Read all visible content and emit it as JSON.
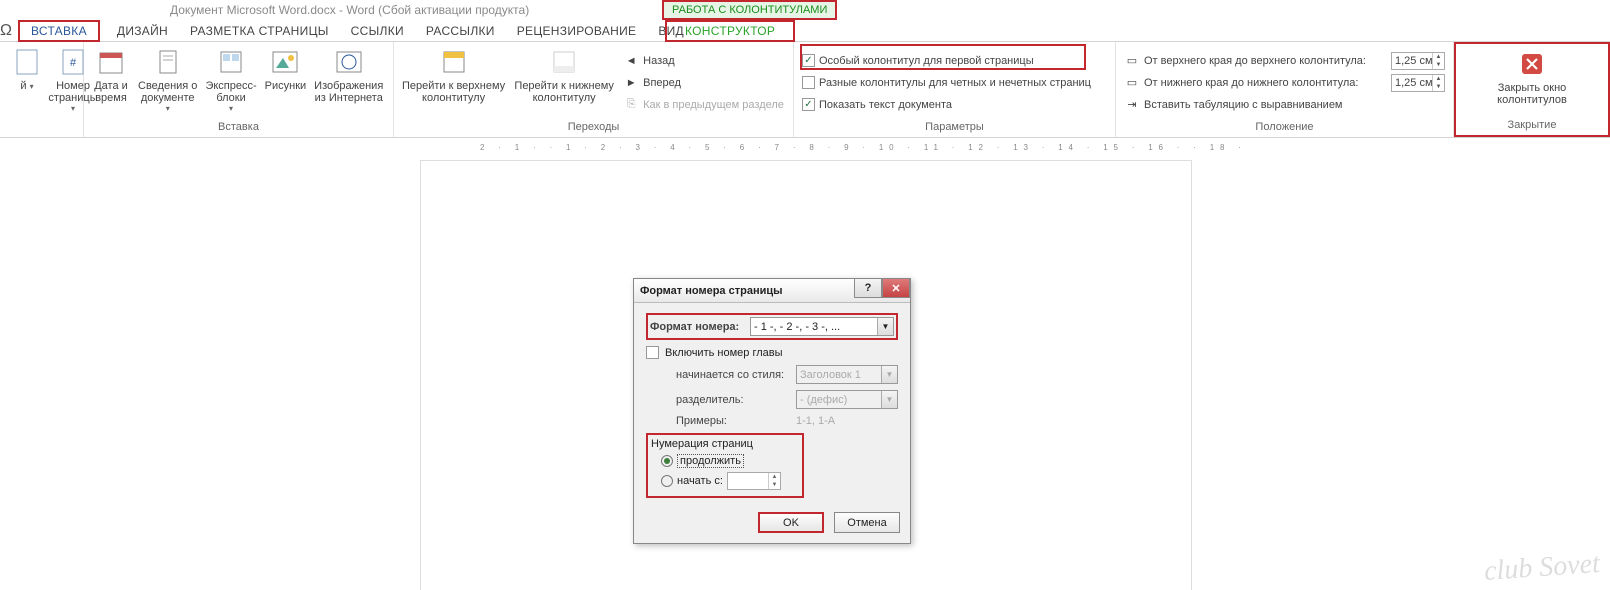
{
  "title": "Документ Microsoft Word.docx - Word (Сбой активации продукта)",
  "contextual_tab_title": "РАБОТА С КОЛОНТИТУЛАМИ",
  "tabs": {
    "vstavka": "ВСТАВКА",
    "dizain": "ДИЗАЙН",
    "razmetka": "РАЗМЕТКА СТРАНИЦЫ",
    "ssylki": "ССЫЛКИ",
    "rassylki": "РАССЫЛКИ",
    "recenz": "РЕЦЕНЗИРОВАНИЕ",
    "vid": "ВИД",
    "konstruktor": "КОНСТРУКТОР"
  },
  "ribbon": {
    "hf": {
      "nomer": "Номер\nстраницы",
      "group": ""
    },
    "insert": {
      "data": "Дата и\nвремя",
      "sved": "Сведения о\nдокументе",
      "express": "Экспресс-\nблоки",
      "risunki": "Рисунки",
      "izobr": "Изображения\nиз Интернета",
      "group": "Вставка"
    },
    "nav": {
      "top": "Перейти к верхнему\nколонтитулу",
      "bottom": "Перейти к нижнему\nколонтитулу",
      "back": "Назад",
      "fwd": "Вперед",
      "prev": "Как в предыдущем разделе",
      "group": "Переходы"
    },
    "params": {
      "first": "Особый колонтитул для первой страницы",
      "oddeven": "Разные колонтитулы для четных и нечетных страниц",
      "showtext": "Показать текст документа",
      "group": "Параметры"
    },
    "position": {
      "top_lbl": "От верхнего края до верхнего колонтитула:",
      "bottom_lbl": "От нижнего края до нижнего колонтитула:",
      "tab_lbl": "Вставить табуляцию с выравниванием",
      "top_val": "1,25 см",
      "bottom_val": "1,25 см",
      "group": "Положение"
    },
    "close": {
      "label": "Закрыть окно\nколонтитулов",
      "group": "Закрытие"
    }
  },
  "ruler": "2 · 1 ·   · 1 · 2 · 3 · 4 · 5 · 6 · 7 · 8 · 9 · 10 · 11 · 12 · 13 · 14 · 15 · 16 ·   · 18 ·",
  "dialog": {
    "title": "Формат номера страницы",
    "format_lbl": "Формат номера:",
    "format_val": "- 1 -, - 2 -, - 3 -, ...",
    "include_chapter": "Включить номер главы",
    "starts_style_lbl": "начинается со стиля:",
    "starts_style_val": "Заголовок 1",
    "separator_lbl": "разделитель:",
    "separator_val": "-       (дефис)",
    "examples_lbl": "Примеры:",
    "examples_val": "1-1, 1-A",
    "numbering_title": "Нумерация страниц",
    "continue": "продолжить",
    "start_at": "начать с:",
    "ok": "OK",
    "cancel": "Отмена",
    "help": "?",
    "close": "✕"
  },
  "watermark": "club Sovet"
}
